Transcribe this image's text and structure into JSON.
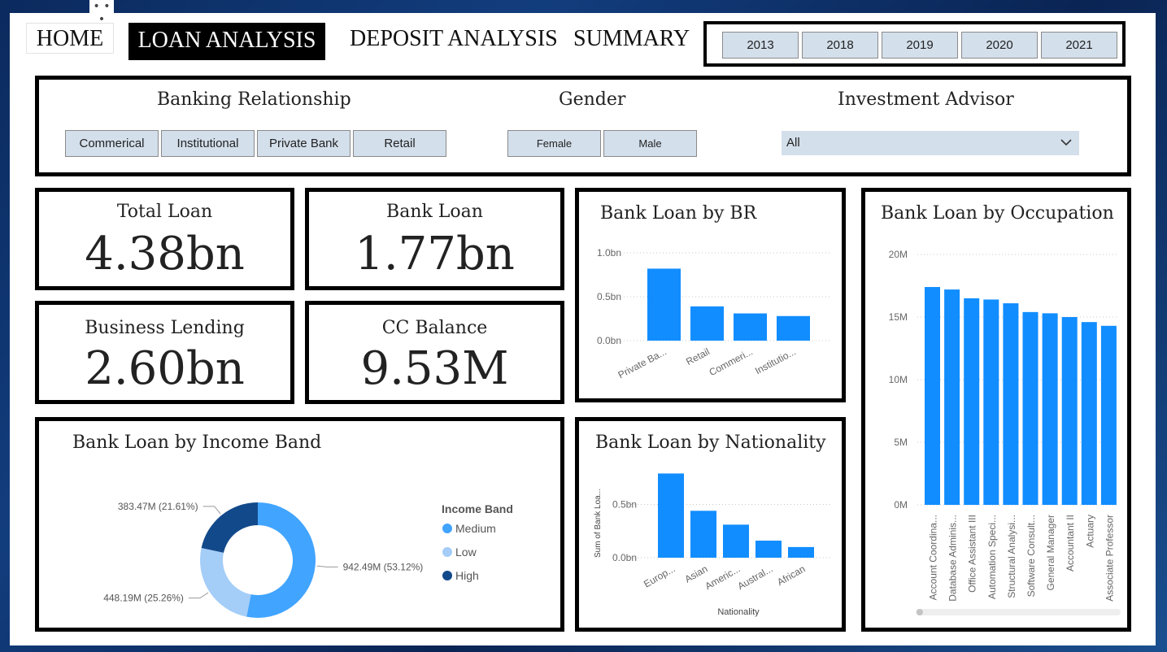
{
  "nav": {
    "home": "HOME",
    "loan_analysis": "LOAN ANALYSIS",
    "deposit_analysis": "DEPOSIT ANALYSIS",
    "summary": "SUMMARY"
  },
  "years": [
    "2013",
    "2018",
    "2019",
    "2020",
    "2021"
  ],
  "filters": {
    "banking_relationship": {
      "title": "Banking Relationship",
      "options": [
        "Commerical",
        "Institutional",
        "Private Bank",
        "Retail"
      ]
    },
    "gender": {
      "title": "Gender",
      "options": [
        "Female",
        "Male"
      ]
    },
    "investment_advisor": {
      "title": "Investment Advisor",
      "value": "All"
    }
  },
  "kpis": {
    "total_loan": {
      "title": "Total Loan",
      "value": "4.38bn"
    },
    "bank_loan": {
      "title": "Bank Loan",
      "value": "1.77bn"
    },
    "business_lending": {
      "title": "Business Lending",
      "value": "2.60bn"
    },
    "cc_balance": {
      "title": "CC Balance",
      "value": "9.53M"
    }
  },
  "colors": {
    "bar": "#118dff",
    "medium": "#41a4ff",
    "low": "#a4cdf8",
    "high": "#12498a",
    "filter_bg": "#d3dfeb"
  },
  "icons": {
    "dropdown": "chevron-down-icon",
    "more": "more-options-icon"
  },
  "chart_data": [
    {
      "id": "br",
      "type": "bar",
      "title": "Bank Loan by BR",
      "categories": [
        "Private Ba...",
        "Retail",
        "Commeri...",
        "Institutio..."
      ],
      "values": [
        0.82,
        0.39,
        0.31,
        0.28
      ],
      "ticks": [
        {
          "v": 0,
          "label": "0.0bn"
        },
        {
          "v": 0.5,
          "label": "0.5bn"
        },
        {
          "v": 1.0,
          "label": "1.0bn"
        }
      ],
      "ylim": [
        0,
        1.0
      ]
    },
    {
      "id": "nationality",
      "type": "bar",
      "title": "Bank Loan by Nationality",
      "xlabel": "Nationality",
      "ylabel": "Sum of Bank Loa...",
      "categories": [
        "Europ...",
        "Asian",
        "Americ...",
        "Austral...",
        "African"
      ],
      "values": [
        0.79,
        0.44,
        0.31,
        0.16,
        0.1
      ],
      "ticks": [
        {
          "v": 0,
          "label": "0.0bn"
        },
        {
          "v": 0.5,
          "label": "0.5bn"
        }
      ],
      "ylim": [
        0,
        0.9
      ]
    },
    {
      "id": "occupation",
      "type": "bar",
      "title": "Bank Loan by Occupation",
      "categories": [
        "Account Coordina...",
        "Database Adminis...",
        "Office Assistant III",
        "Automation Speci...",
        "Structural Analysi...",
        "Software Consult...",
        "General Manager",
        "Accountant II",
        "Actuary",
        "Associate Professor"
      ],
      "values": [
        17.4,
        17.2,
        16.5,
        16.4,
        16.1,
        15.4,
        15.3,
        15.0,
        14.6,
        14.3
      ],
      "ticks": [
        {
          "v": 0,
          "label": "0M"
        },
        {
          "v": 5,
          "label": "5M"
        },
        {
          "v": 10,
          "label": "10M"
        },
        {
          "v": 15,
          "label": "15M"
        },
        {
          "v": 20,
          "label": "20M"
        }
      ],
      "ylim": [
        0,
        20
      ]
    },
    {
      "id": "income",
      "type": "pie",
      "title": "Bank Loan by Income Band",
      "legend_title": "Income Band",
      "slices": [
        {
          "name": "Medium",
          "value": 942.49,
          "label": "942.49M (53.12%)",
          "color": "#41a4ff"
        },
        {
          "name": "Low",
          "value": 448.19,
          "label": "448.19M (25.26%)",
          "color": "#a4cdf8"
        },
        {
          "name": "High",
          "value": 383.47,
          "label": "383.47M (21.61%)",
          "color": "#12498a"
        }
      ]
    }
  ]
}
